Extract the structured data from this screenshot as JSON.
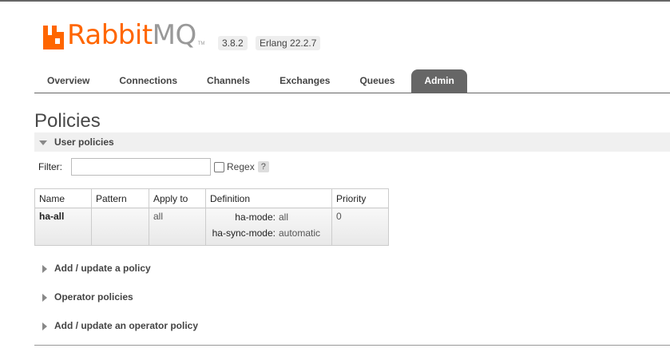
{
  "header": {
    "logo_rabbit": "Rabbit",
    "logo_mq": "MQ",
    "logo_tm": "TM",
    "version": "3.8.2",
    "erlang": "Erlang 22.2.7"
  },
  "tabs": [
    {
      "label": "Overview"
    },
    {
      "label": "Connections"
    },
    {
      "label": "Channels"
    },
    {
      "label": "Exchanges"
    },
    {
      "label": "Queues"
    },
    {
      "label": "Admin"
    }
  ],
  "page_title": "Policies",
  "user_policies": {
    "header": "User policies",
    "filter_label": "Filter:",
    "filter_value": "",
    "regex_label": "Regex",
    "help_label": "?",
    "columns": [
      "Name",
      "Pattern",
      "Apply to",
      "Definition",
      "Priority"
    ],
    "rows": [
      {
        "name": "ha-all",
        "pattern": "",
        "apply_to": "all",
        "definition": [
          {
            "key": "ha-mode:",
            "value": "all"
          },
          {
            "key": "ha-sync-mode:",
            "value": "automatic"
          }
        ],
        "priority": "0"
      }
    ]
  },
  "sections": {
    "add_policy": "Add / update a policy",
    "operator_policies": "Operator policies",
    "add_operator_policy": "Add / update an operator policy"
  },
  "colors": {
    "brand_orange": "#ff6600",
    "active_tab": "#666666"
  }
}
